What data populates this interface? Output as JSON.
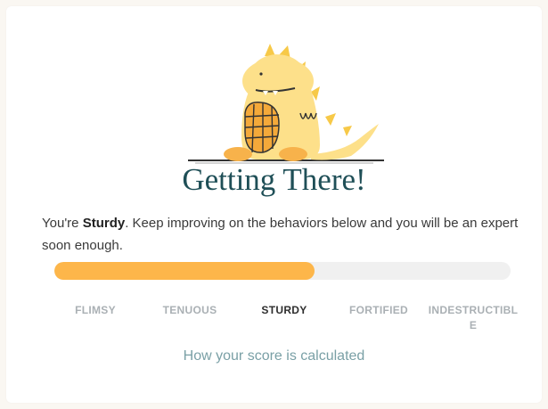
{
  "status": {
    "title": "Getting There!",
    "message_prefix": "You're ",
    "level_name": "Sturdy",
    "message_suffix": ". Keep improving on the behaviors below and you will be an expert soon enough."
  },
  "progress": {
    "fraction": 0.57,
    "fill_color": "#fdb64a",
    "track_color": "#f0f0f0"
  },
  "levels": [
    {
      "label": "FLIMSY",
      "active": false
    },
    {
      "label": "TENUOUS",
      "active": false
    },
    {
      "label": "STURDY",
      "active": true
    },
    {
      "label": "FORTIFIED",
      "active": false
    },
    {
      "label": "INDESTRUCTIBLE",
      "active": false
    }
  ],
  "calc_link": "How your score is calculated",
  "illustration": "yellow-dinosaur-with-waffle-icon"
}
